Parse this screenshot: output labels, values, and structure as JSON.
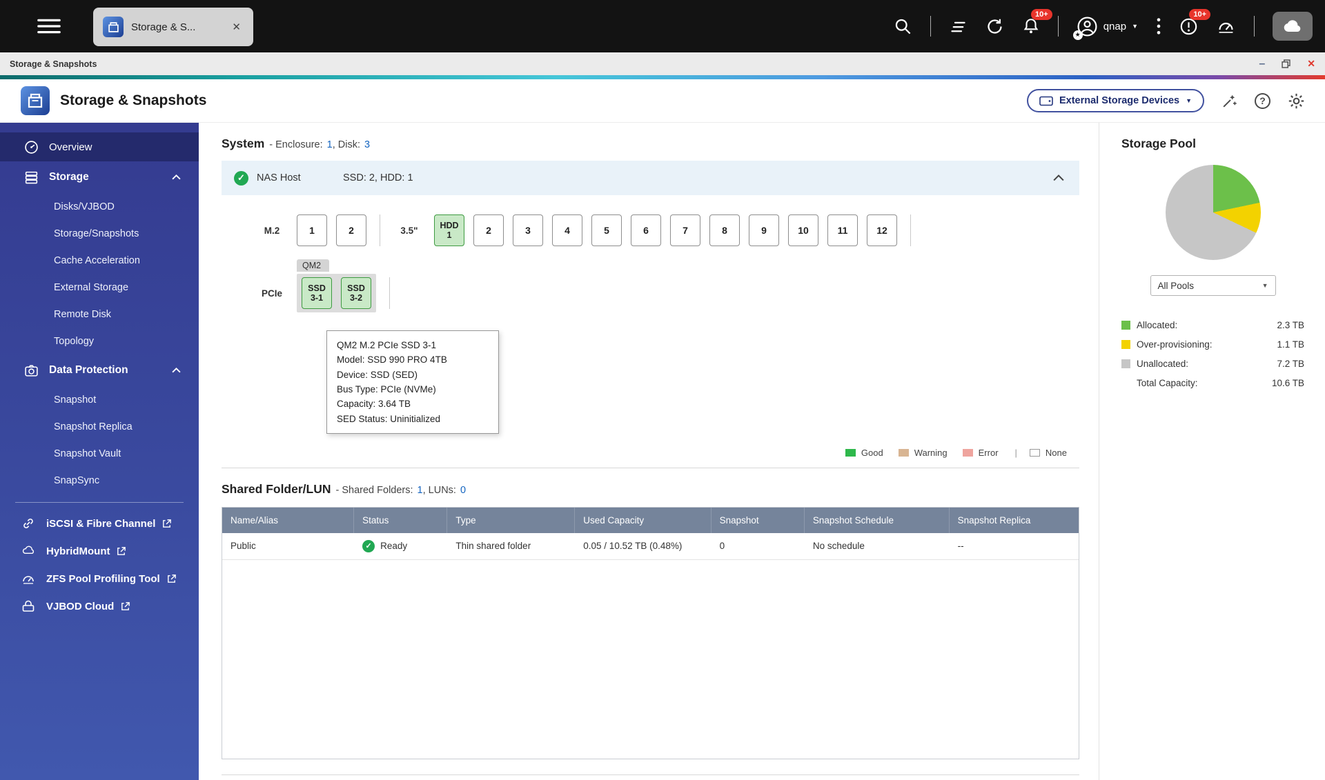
{
  "icons": {
    "check": "✓",
    "close": "✕",
    "caret_down": "▼",
    "minimize": "–",
    "star": "★",
    "question": "?",
    "divider": "|"
  },
  "topbar": {
    "tab_label": "Storage & S...",
    "user_name": "qnap",
    "notification_badge": "10+",
    "event_badge": "10+"
  },
  "titlebar": {
    "title": "Storage & Snapshots"
  },
  "header": {
    "app_title": "Storage & Snapshots",
    "device_selector_label": "External Storage Devices"
  },
  "sidebar": {
    "overview_label": "Overview",
    "storage_label": "Storage",
    "storage_items": [
      "Disks/VJBOD",
      "Storage/Snapshots",
      "Cache Acceleration",
      "External Storage",
      "Remote Disk",
      "Topology"
    ],
    "data_protection_label": "Data Protection",
    "data_protection_items": [
      "Snapshot",
      "Snapshot Replica",
      "Snapshot Vault",
      "SnapSync"
    ],
    "tool_items": [
      "iSCSI & Fibre Channel",
      "HybridMount",
      "ZFS Pool Profiling Tool",
      "VJBOD Cloud"
    ]
  },
  "system": {
    "title": "System",
    "enclosure_label": "- Enclosure:",
    "enclosure_value": "1",
    "disk_label": ", Disk:",
    "disk_value": "3",
    "nas_host_label": "NAS Host",
    "nas_host_summary": "SSD: 2, HDD: 1",
    "m2_label": "M.2",
    "m2_slots": [
      "1",
      "2"
    ],
    "bay_label": "3.5\"",
    "hdd_slot": {
      "line1": "HDD",
      "line2": "1"
    },
    "bay_slots": [
      "2",
      "3",
      "4",
      "5",
      "6",
      "7",
      "8",
      "9",
      "10",
      "11",
      "12"
    ],
    "qm2_label": "QM2",
    "pcie_label": "PCIe",
    "ssd_slots": [
      {
        "line1": "SSD",
        "line2": "3-1"
      },
      {
        "line1": "SSD",
        "line2": "3-2"
      }
    ],
    "tooltip_lines": [
      "QM2 M.2 PCIe SSD 3-1",
      "Model: SSD 990 PRO 4TB",
      "Device: SSD (SED)",
      "Bus Type: PCIe (NVMe)",
      "Capacity: 3.64 TB",
      "SED Status: Uninitialized"
    ],
    "legend": {
      "good": {
        "label": "Good",
        "color": "#2eb84b"
      },
      "warning": {
        "label": "Warning",
        "color": "#d8b593"
      },
      "error": {
        "label": "Error",
        "color": "#efa49e"
      },
      "none": {
        "label": "None",
        "color": "#ffffff"
      }
    }
  },
  "shared": {
    "title": "Shared Folder/LUN",
    "folders_label": "- Shared Folders:",
    "folders_value": "1",
    "luns_label": ", LUNs:",
    "luns_value": "0",
    "headers": [
      "Name/Alias",
      "Status",
      "Type",
      "Used Capacity",
      "Snapshot",
      "Snapshot Schedule",
      "Snapshot Replica"
    ],
    "row": {
      "name": "Public",
      "status": "Ready",
      "type": "Thin shared folder",
      "used": "0.05 / 10.52 TB (0.48%)",
      "snapshot": "0",
      "schedule": "No schedule",
      "replica": "--"
    }
  },
  "pool": {
    "title": "Storage Pool",
    "selector_value": "All Pools",
    "stats": [
      {
        "label": "Allocated:",
        "value": "2.3 TB",
        "color": "#6cc04a"
      },
      {
        "label": "Over-provisioning:",
        "value": "1.1 TB",
        "color": "#f3d200"
      },
      {
        "label": "Unallocated:",
        "value": "7.2 TB",
        "color": "#c6c6c6"
      }
    ],
    "total_label": "Total Capacity:",
    "total_value": "10.6 TB"
  },
  "chart_data": {
    "type": "pie",
    "title": "Storage Pool",
    "labels": [
      "Allocated",
      "Over-provisioning",
      "Unallocated"
    ],
    "values": [
      2.3,
      1.1,
      7.2
    ],
    "unit": "TB",
    "colors": [
      "#6cc04a",
      "#f3d200",
      "#c6c6c6"
    ],
    "total": {
      "label": "Total Capacity",
      "value": 10.6
    },
    "legend_position": "below"
  }
}
